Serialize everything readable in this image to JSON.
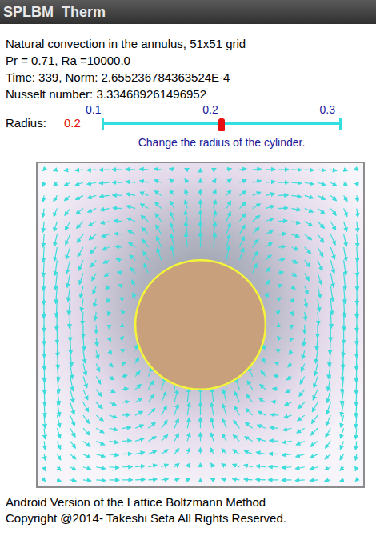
{
  "window": {
    "title": "SPLBM_Therm"
  },
  "info": [
    "Natural convection in the annulus, 51x51 grid",
    "Pr = 0.71, Ra =10000.0",
    "Time: 339, Norm: 2.655236784363524E-4",
    "Nusselt number: 3.334689261496952"
  ],
  "slider": {
    "label": "Radius:",
    "value": "0.2",
    "ticks": [
      "0.1",
      "0.2",
      "0.3"
    ],
    "level": 0.5,
    "hint": "Change the radius of the cylinder."
  },
  "footer": [
    "Android Version of the Lattice Boltzmann Method",
    "Copyright @2014- Takeshi Seta All Rights Reserved."
  ]
}
